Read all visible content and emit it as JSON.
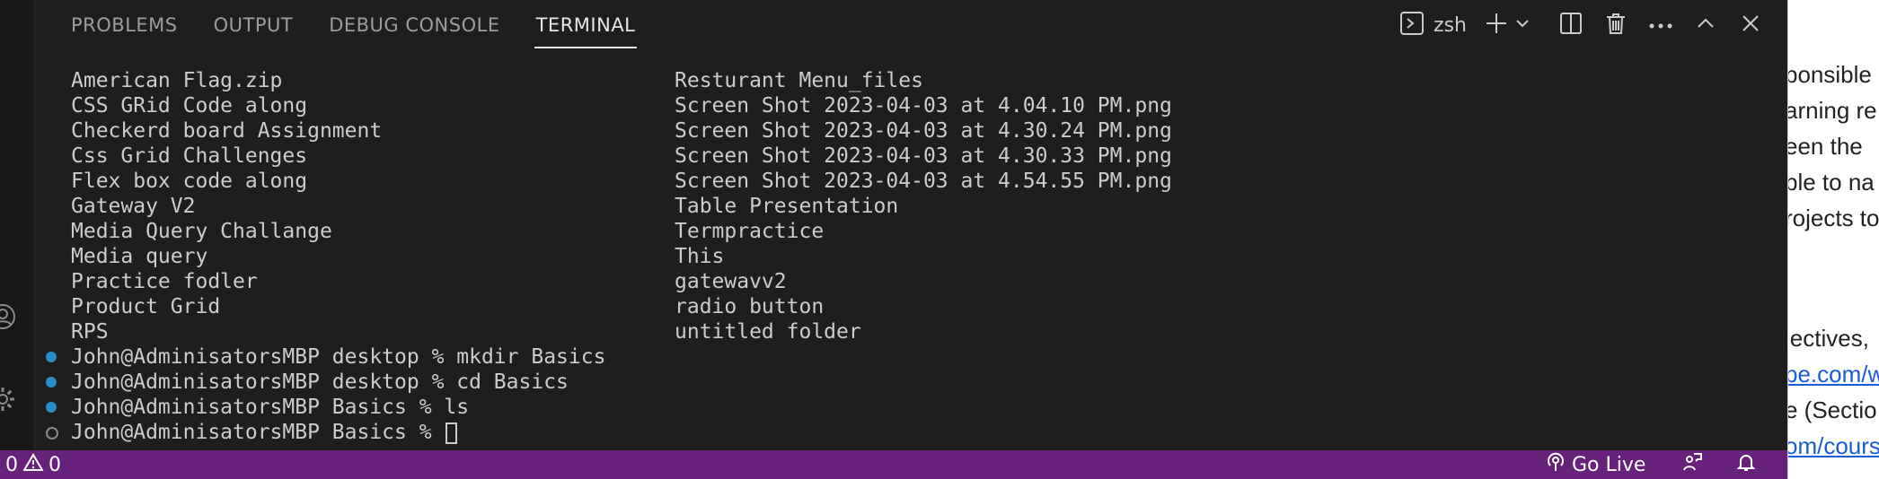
{
  "panel": {
    "tabs": [
      {
        "label": "PROBLEMS"
      },
      {
        "label": "OUTPUT"
      },
      {
        "label": "DEBUG CONSOLE"
      },
      {
        "label": "TERMINAL",
        "active": true
      }
    ],
    "toolbar": {
      "shell_name": "zsh",
      "icons": [
        "terminal-shell-icon",
        "new-terminal-icon",
        "chevron-down-icon",
        "split-terminal-icon",
        "trash-icon",
        "more-actions-icon",
        "maximize-panel-icon",
        "close-panel-icon"
      ]
    }
  },
  "terminal": {
    "listing": [
      {
        "left": "American Flag.zip",
        "right": "Resturant Menu_files"
      },
      {
        "left": "CSS GRid Code along",
        "right": "Screen Shot 2023-04-03 at 4.04.10 PM.png"
      },
      {
        "left": "Checkerd board Assignment",
        "right": "Screen Shot 2023-04-03 at 4.30.24 PM.png"
      },
      {
        "left": "Css Grid Challenges",
        "right": "Screen Shot 2023-04-03 at 4.30.33 PM.png"
      },
      {
        "left": "Flex box code along",
        "right": "Screen Shot 2023-04-03 at 4.54.55 PM.png"
      },
      {
        "left": "Gateway V2",
        "right": "Table Presentation"
      },
      {
        "left": "Media Query Challange",
        "right": "Termpractice"
      },
      {
        "left": "Media query",
        "right": "This"
      },
      {
        "left": "Practice fodler",
        "right": "gatewavv2"
      },
      {
        "left": "Product Grid",
        "right": "radio button"
      },
      {
        "left": "RPS",
        "right": "untitled folder"
      }
    ],
    "commands": [
      {
        "text": "John@AdminisatorsMBP desktop % mkdir Basics",
        "status": "done"
      },
      {
        "text": "John@AdminisatorsMBP desktop % cd Basics",
        "status": "done"
      },
      {
        "text": "John@AdminisatorsMBP Basics % ls",
        "status": "done"
      },
      {
        "text": "John@AdminisatorsMBP Basics % ",
        "status": "pending"
      }
    ]
  },
  "statusbar": {
    "errors": "0",
    "warnings": "0",
    "go_live": "Go Live"
  },
  "side_page": {
    "lines": [
      {
        "text": "ponsible",
        "link": false
      },
      {
        "text": "arning re",
        "link": false
      },
      {
        "text": "een the",
        "link": false
      },
      {
        "text": "ble to na",
        "link": false
      },
      {
        "text": "rojects to",
        "link": false
      },
      {
        "text": "jectives,",
        "link": false
      },
      {
        "text": "be.com/w",
        "link": true
      },
      {
        "text": "e (Sectio",
        "link": false
      },
      {
        "text": "om/cours",
        "link": true
      }
    ]
  },
  "colors": {
    "statusbar_bg": "#68217a",
    "accent_blue": "#2b8bc4",
    "terminal_bg": "#1e1e1e"
  }
}
